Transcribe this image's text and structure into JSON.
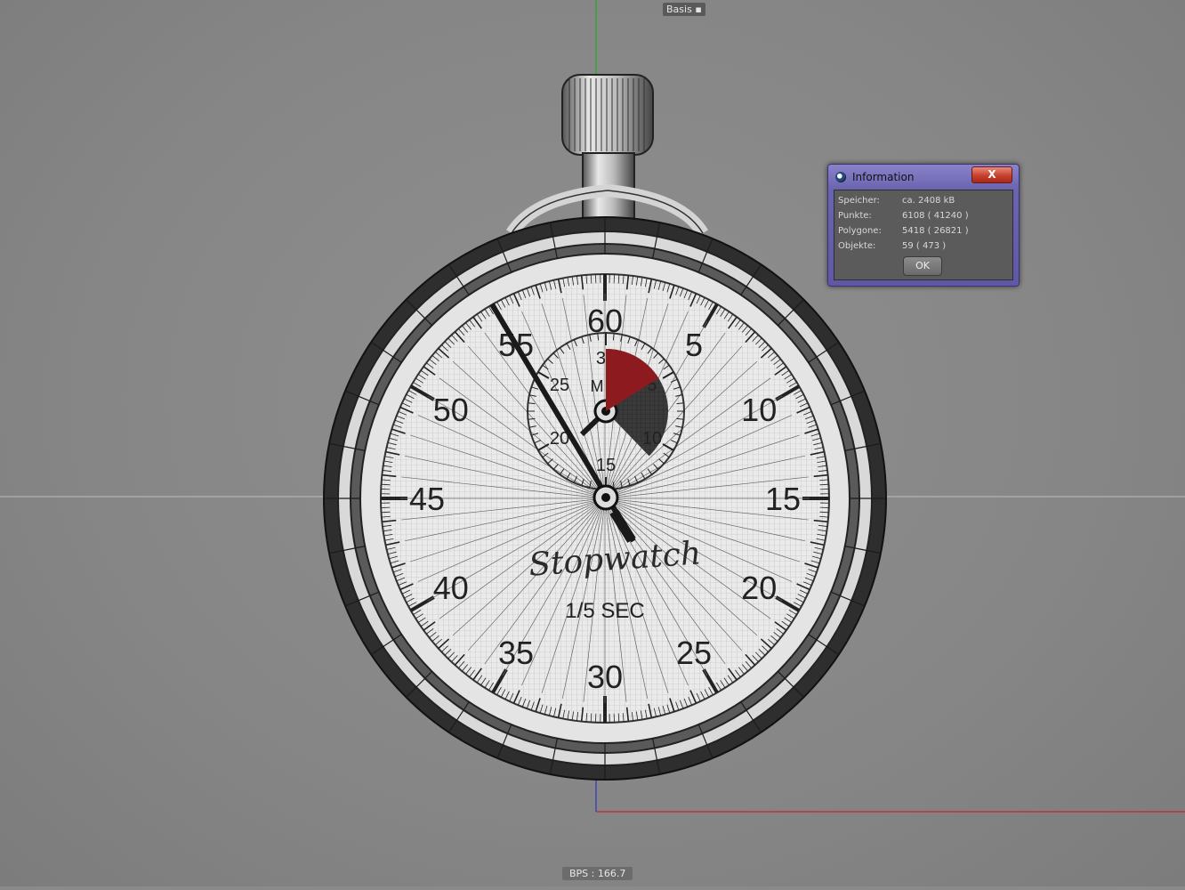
{
  "viewport": {
    "view_name": "Basis",
    "fps_label": "BPS : 166.7",
    "colors": {
      "background": "#8a8a8a",
      "axis_x": "#d01010",
      "axis_y": "#10b010",
      "axis_z": "#2020d0"
    }
  },
  "stopwatch": {
    "outer_numerals": [
      "60",
      "5",
      "10",
      "15",
      "20",
      "25",
      "30",
      "35",
      "40",
      "45",
      "50",
      "55"
    ],
    "inner_numerals": [
      "30",
      "5",
      "10",
      "15",
      "20",
      "25"
    ],
    "inner_label": "M",
    "brand": "Stopwatch",
    "caption": "1/5 SEC",
    "accent_color": "#8d1a1f"
  },
  "dialog": {
    "title": "Information",
    "close_label": "X",
    "rows": [
      {
        "label": "Speicher:",
        "value": "ca. 2408 kB"
      },
      {
        "label": "Punkte:",
        "value": "6108 ( 41240 )"
      },
      {
        "label": "Polygone:",
        "value": "5418 ( 26821 )"
      },
      {
        "label": "Objekte:",
        "value": "59 ( 473 )"
      }
    ],
    "ok_label": "OK"
  }
}
